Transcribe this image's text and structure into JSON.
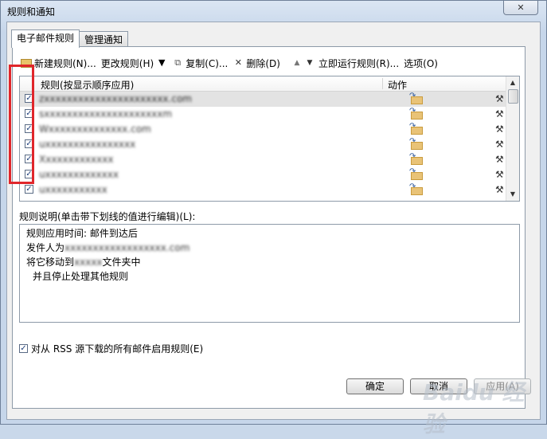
{
  "window": {
    "title": "规则和通知",
    "close": "✕"
  },
  "tabs": [
    {
      "label": "电子邮件规则"
    },
    {
      "label": "管理通知"
    }
  ],
  "toolbar": {
    "new_rule": "新建规则(N)...",
    "change_rule": "更改规则(H)",
    "copy": "复制(C)...",
    "delete": "删除(D)",
    "run_now": "立即运行规则(R)...",
    "options": "选项(O)"
  },
  "list": {
    "header_rule": "规则(按显示顺序应用)",
    "header_action": "动作",
    "rows": [
      {
        "name": "zxxxxxxxxxxxxxxxxxxxxxx.com",
        "checked": true,
        "selected": true
      },
      {
        "name": "sxxxxxxxxxxxxxxxxxxxxxm",
        "checked": true,
        "selected": false
      },
      {
        "name": "Wxxxxxxxxxxxxxx.com",
        "checked": true,
        "selected": false
      },
      {
        "name": "uxxxxxxxxxxxxxxxx",
        "checked": true,
        "selected": false
      },
      {
        "name": "Xxxxxxxxxxxxx",
        "checked": true,
        "selected": false
      },
      {
        "name": "uxxxxxxxxxxxxx",
        "checked": true,
        "selected": false
      },
      {
        "name": "uxxxxxxxxxxx",
        "checked": true,
        "selected": false
      }
    ]
  },
  "description": {
    "label": "规则说明(单击带下划线的值进行编辑)(L):",
    "line1": "规则应用时间: 邮件到达后",
    "line2_prefix": "发件人为",
    "line2_value": "xxxxxxxxxxxxxxxxxx.com",
    "line3_prefix": "将它移动到",
    "line3_value": "xxxxx",
    "line3_suffix": "文件夹中",
    "line4": "并且停止处理其他规则"
  },
  "rss": {
    "label": "对从 RSS 源下载的所有邮件启用规则(E)",
    "checked": true
  },
  "buttons": {
    "ok": "确定",
    "cancel": "取消",
    "apply": "应用(A)"
  },
  "watermark": "Baidu 经验"
}
